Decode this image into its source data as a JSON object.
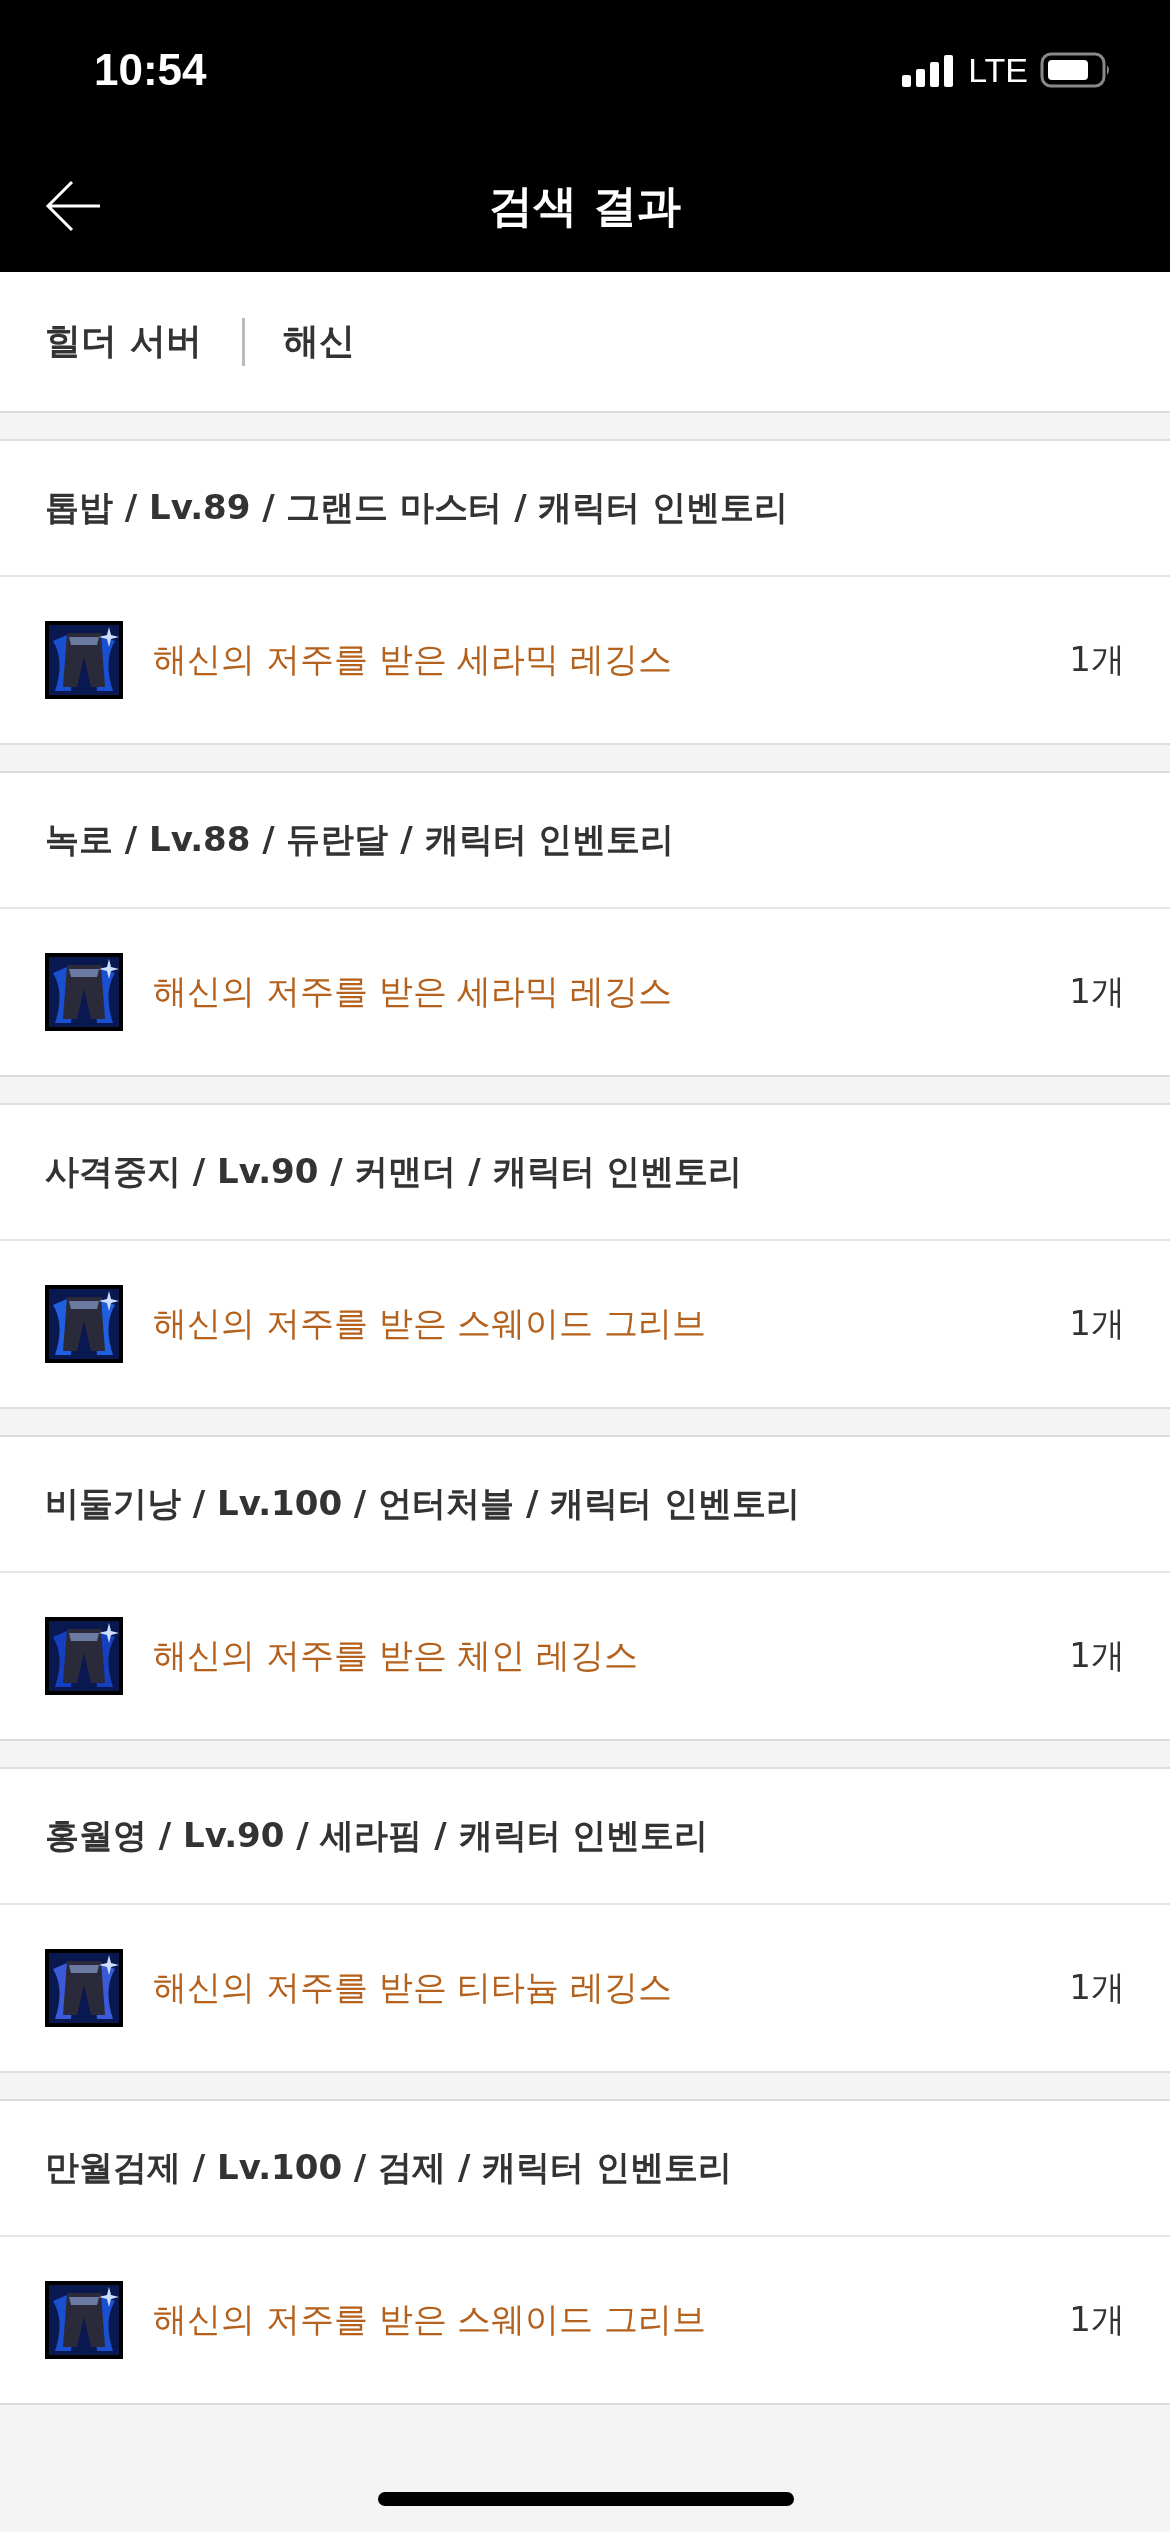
{
  "status_bar": {
    "time": "10:54",
    "network": "LTE"
  },
  "header": {
    "title": "검색 결과"
  },
  "filter": {
    "server": "힐더 서버",
    "query": "해신"
  },
  "results": [
    {
      "title": "톱밥 / Lv.89 / 그랜드 마스터 / 캐릭터 인벤토리",
      "item": "해신의 저주를 받은 세라믹 레깅스",
      "count": "1개"
    },
    {
      "title": "녹로 / Lv.88 / 듀란달 / 캐릭터 인벤토리",
      "item": "해신의 저주를 받은 세라믹 레깅스",
      "count": "1개"
    },
    {
      "title": "사격중지 / Lv.90 / 커맨더 / 캐릭터 인벤토리",
      "item": "해신의 저주를 받은 스웨이드 그리브",
      "count": "1개"
    },
    {
      "title": "비둘기낭 / Lv.100 / 언터처블 / 캐릭터 인벤토리",
      "item": "해신의 저주를 받은 체인 레깅스",
      "count": "1개"
    },
    {
      "title": "홍월영 / Lv.90 / 세라핌 / 캐릭터 인벤토리",
      "item": "해신의 저주를 받은 티타늄 레깅스",
      "count": "1개"
    },
    {
      "title": "만월검제 / Lv.100 / 검제 / 캐릭터 인벤토리",
      "item": "해신의 저주를 받은 스웨이드 그리브",
      "count": "1개"
    }
  ]
}
